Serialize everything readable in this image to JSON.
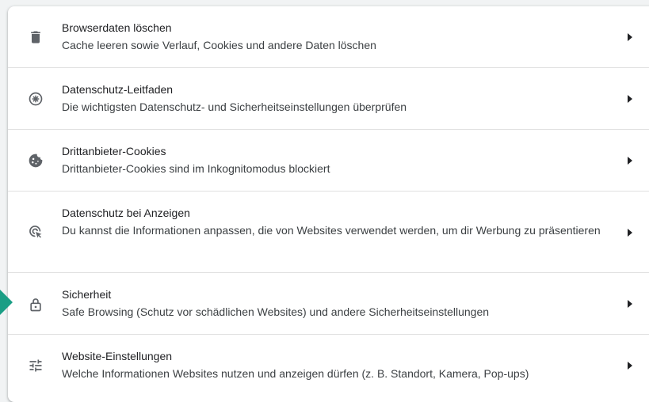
{
  "colors": {
    "icon": "#5f6368",
    "pointer": "#1a9e85"
  },
  "items": [
    {
      "title": "Browserdaten löschen",
      "desc": "Cache leeren sowie Verlauf, Cookies und andere Daten löschen",
      "icon": "trash-icon"
    },
    {
      "title": "Datenschutz-Leitfaden",
      "desc": "Die wichtigsten Datenschutz- und Sicherheitseinstellungen überprüfen",
      "icon": "privacy-guide-icon"
    },
    {
      "title": "Drittanbieter-Cookies",
      "desc": "Drittanbieter-Cookies sind im Inkognitomodus blockiert",
      "icon": "cookie-icon"
    },
    {
      "title": "Datenschutz bei Anzeigen",
      "desc": "Du kannst die Informationen anpassen, die von Websites verwendet werden, um dir Werbung zu präsentieren",
      "icon": "ad-privacy-icon"
    },
    {
      "title": "Sicherheit",
      "desc": "Safe Browsing (Schutz vor schädlichen Websites) und andere Sicherheitseinstellungen",
      "icon": "lock-icon"
    },
    {
      "title": "Website-Einstellungen",
      "desc": "Welche Informationen Websites nutzen und anzeigen dürfen (z. B. Standort, Kamera, Pop-ups)",
      "icon": "tune-icon"
    }
  ]
}
